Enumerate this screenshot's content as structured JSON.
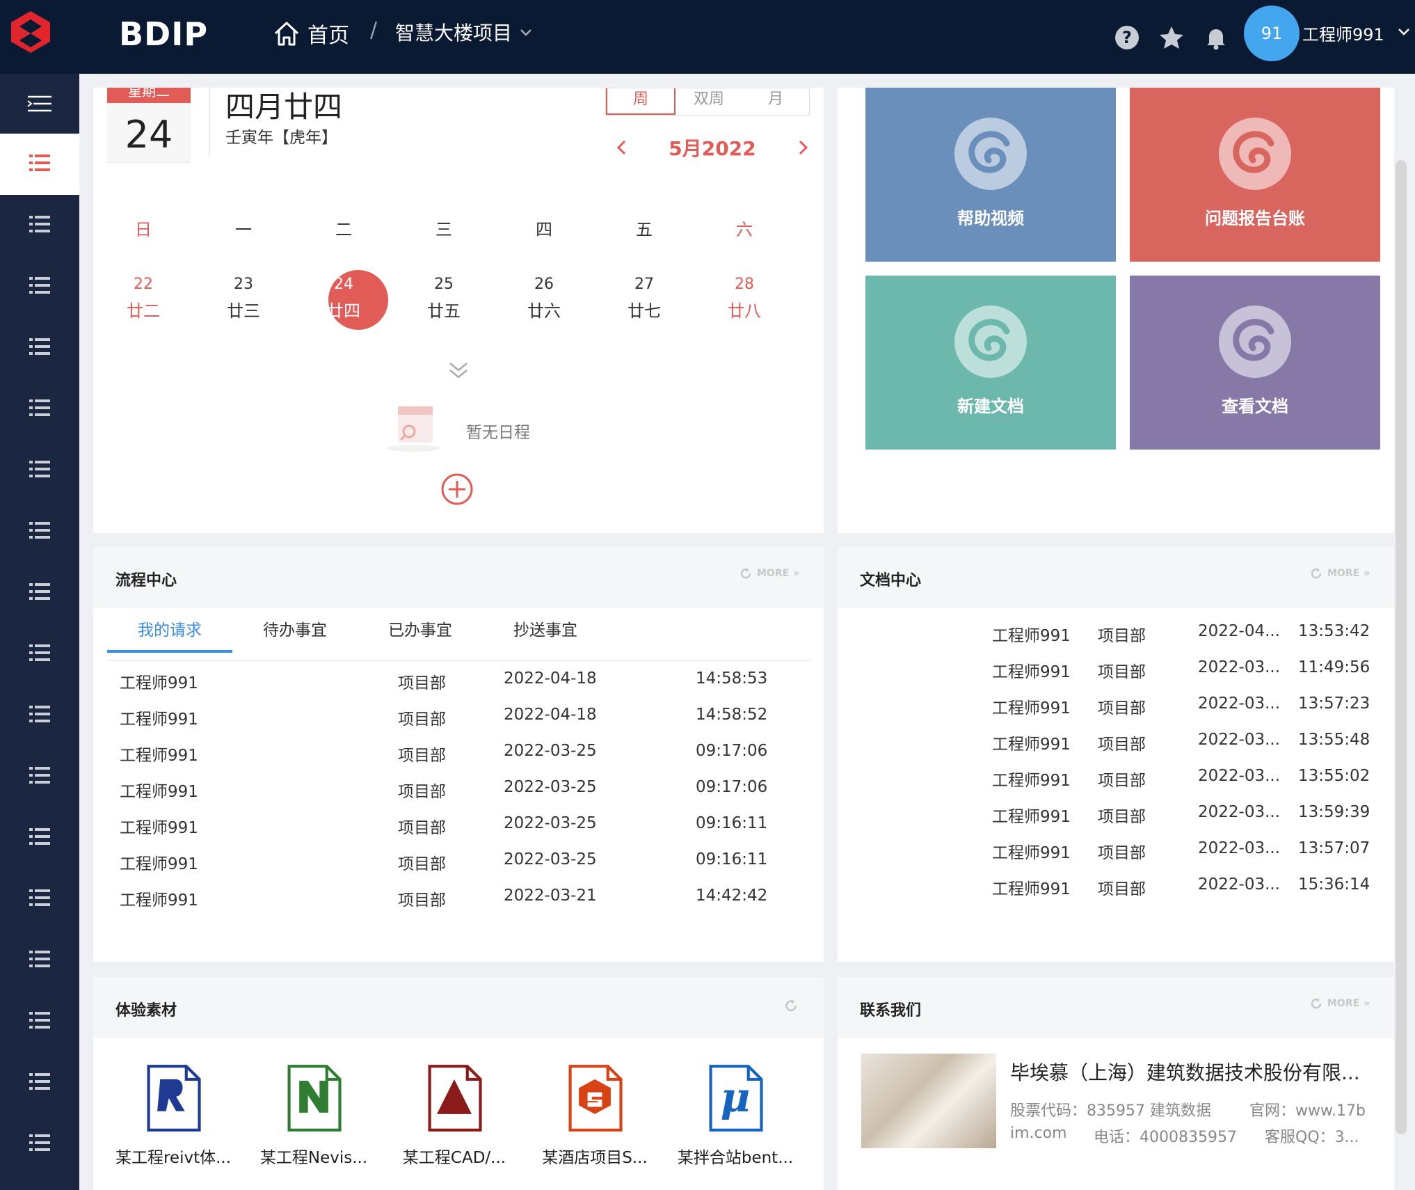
{
  "topbar": {
    "brand": "BDIP",
    "home_label": "首页",
    "separator": "/",
    "project_label": "智慧大楼项目",
    "avatar_text": "91",
    "user_name": "工程师991",
    "colors": {
      "bg": "#0b1a33",
      "accent": "#e15b57",
      "avatar": "#45a6f0"
    }
  },
  "sidebar": {
    "item_count": 17,
    "active_index": 0
  },
  "calendar": {
    "weekday_label": "星期二",
    "day": "24",
    "lunar_date": "四月廿四",
    "lunar_year": "壬寅年【虎年】",
    "view_modes": [
      "周",
      "双周",
      "月"
    ],
    "active_view": "周",
    "month_label": "5月2022",
    "week_headers": [
      "日",
      "一",
      "二",
      "三",
      "四",
      "五",
      "六"
    ],
    "days": [
      {
        "num": "22",
        "lunar": "廿二",
        "weekend": true
      },
      {
        "num": "23",
        "lunar": "廿三",
        "weekend": false
      },
      {
        "num": "24",
        "lunar": "廿四",
        "weekend": false,
        "today": true
      },
      {
        "num": "25",
        "lunar": "廿五",
        "weekend": false
      },
      {
        "num": "26",
        "lunar": "廿六",
        "weekend": false
      },
      {
        "num": "27",
        "lunar": "廿七",
        "weekend": false
      },
      {
        "num": "28",
        "lunar": "廿八",
        "weekend": true
      }
    ],
    "empty_text": "暂无日程"
  },
  "tiles": [
    {
      "label": "帮助视频",
      "color": "#6a8fbb"
    },
    {
      "label": "问题报告台账",
      "color": "#d9655f"
    },
    {
      "label": "新建文档",
      "color": "#6cb8ad"
    },
    {
      "label": "查看文档",
      "color": "#8679a8"
    }
  ],
  "process": {
    "title": "流程中心",
    "more": "MORE",
    "tabs": [
      "我的请求",
      "待办事宜",
      "已办事宜",
      "抄送事宜"
    ],
    "rows": [
      {
        "user": "工程师991",
        "dept": "项目部",
        "date": "2022-04-18",
        "time": "14:58:53"
      },
      {
        "user": "工程师991",
        "dept": "项目部",
        "date": "2022-04-18",
        "time": "14:58:52"
      },
      {
        "user": "工程师991",
        "dept": "项目部",
        "date": "2022-03-25",
        "time": "09:17:06"
      },
      {
        "user": "工程师991",
        "dept": "项目部",
        "date": "2022-03-25",
        "time": "09:17:06"
      },
      {
        "user": "工程师991",
        "dept": "项目部",
        "date": "2022-03-25",
        "time": "09:16:11"
      },
      {
        "user": "工程师991",
        "dept": "项目部",
        "date": "2022-03-25",
        "time": "09:16:11"
      },
      {
        "user": "工程师991",
        "dept": "项目部",
        "date": "2022-03-21",
        "time": "14:42:42"
      }
    ]
  },
  "docs": {
    "title": "文档中心",
    "more": "MORE",
    "rows": [
      {
        "user": "工程师991",
        "dept": "项目部",
        "date": "2022-04...",
        "time": "13:53:42"
      },
      {
        "user": "工程师991",
        "dept": "项目部",
        "date": "2022-03...",
        "time": "11:49:56"
      },
      {
        "user": "工程师991",
        "dept": "项目部",
        "date": "2022-03...",
        "time": "13:57:23"
      },
      {
        "user": "工程师991",
        "dept": "项目部",
        "date": "2022-03...",
        "time": "13:55:48"
      },
      {
        "user": "工程师991",
        "dept": "项目部",
        "date": "2022-03...",
        "time": "13:55:02"
      },
      {
        "user": "工程师991",
        "dept": "项目部",
        "date": "2022-03...",
        "time": "13:59:39"
      },
      {
        "user": "工程师991",
        "dept": "项目部",
        "date": "2022-03...",
        "time": "13:57:07"
      },
      {
        "user": "工程师991",
        "dept": "项目部",
        "date": "2022-03...",
        "time": "15:36:14"
      }
    ]
  },
  "materials": {
    "title": "体验素材",
    "files": [
      {
        "name": "某工程reivt体...",
        "icon": "revit-icon",
        "color": "#1f3a93"
      },
      {
        "name": "某工程Nevis...",
        "icon": "navisworks-icon",
        "color": "#2e7d32"
      },
      {
        "name": "某工程CAD/...",
        "icon": "autocad-icon",
        "color": "#8b1a1a"
      },
      {
        "name": "某酒店项目S...",
        "icon": "sketchup-icon",
        "color": "#d84315"
      },
      {
        "name": "某拌合站bent...",
        "icon": "microstation-icon",
        "color": "#1565c0"
      }
    ]
  },
  "contact": {
    "title": "联系我们",
    "more": "MORE",
    "company": "毕埃慕（上海）建筑数据技术股份有限...",
    "stock": "股票代码：835957 建筑数据",
    "site_a": "官网：www.17b",
    "site_b": "im.com",
    "phone": "电话：4000835957",
    "qq": "客服QQ：3..."
  }
}
